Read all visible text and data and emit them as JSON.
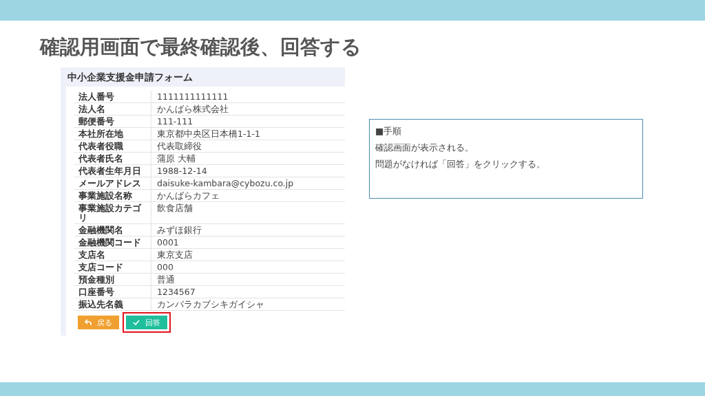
{
  "slide_title": "確認用画面で最終確認後、回答する",
  "form": {
    "title": "中小企業支援金申請フォーム",
    "rows": [
      {
        "label": "法人番号",
        "value": "1111111111111"
      },
      {
        "label": "法人名",
        "value": "かんばら株式会社"
      },
      {
        "label": "郵便番号",
        "value": "111-111"
      },
      {
        "label": "本社所在地",
        "value": "東京都中央区日本橋1-1-1"
      },
      {
        "label": "代表者役職",
        "value": "代表取締役"
      },
      {
        "label": "代表者氏名",
        "value": "蒲原 大輔"
      },
      {
        "label": "代表者生年月日",
        "value": "1988-12-14"
      },
      {
        "label": "メールアドレス",
        "value": "daisuke-kambara@cybozu.co.jp"
      },
      {
        "label": "事業施設名称",
        "value": "かんばらカフェ"
      },
      {
        "label": "事業施設カテゴリ",
        "value": "飲食店舗"
      },
      {
        "label": "金融機関名",
        "value": "みずほ銀行"
      },
      {
        "label": "金融機関コード",
        "value": "0001"
      },
      {
        "label": "支店名",
        "value": "東京支店"
      },
      {
        "label": "支店コード",
        "value": "000"
      },
      {
        "label": "預金種別",
        "value": "普通"
      },
      {
        "label": "口座番号",
        "value": "1234567"
      },
      {
        "label": "振込先名義",
        "value": "カンバラカブシキガイシャ"
      }
    ],
    "buttons": [
      {
        "kind": "back",
        "label": "戻る",
        "highlighted": false
      },
      {
        "kind": "submit",
        "label": "回答",
        "highlighted": true
      }
    ]
  },
  "note": {
    "heading": "■手順",
    "lines": [
      "確認画面が表示される。",
      "問題がなければ「回答」をクリックする。"
    ]
  }
}
